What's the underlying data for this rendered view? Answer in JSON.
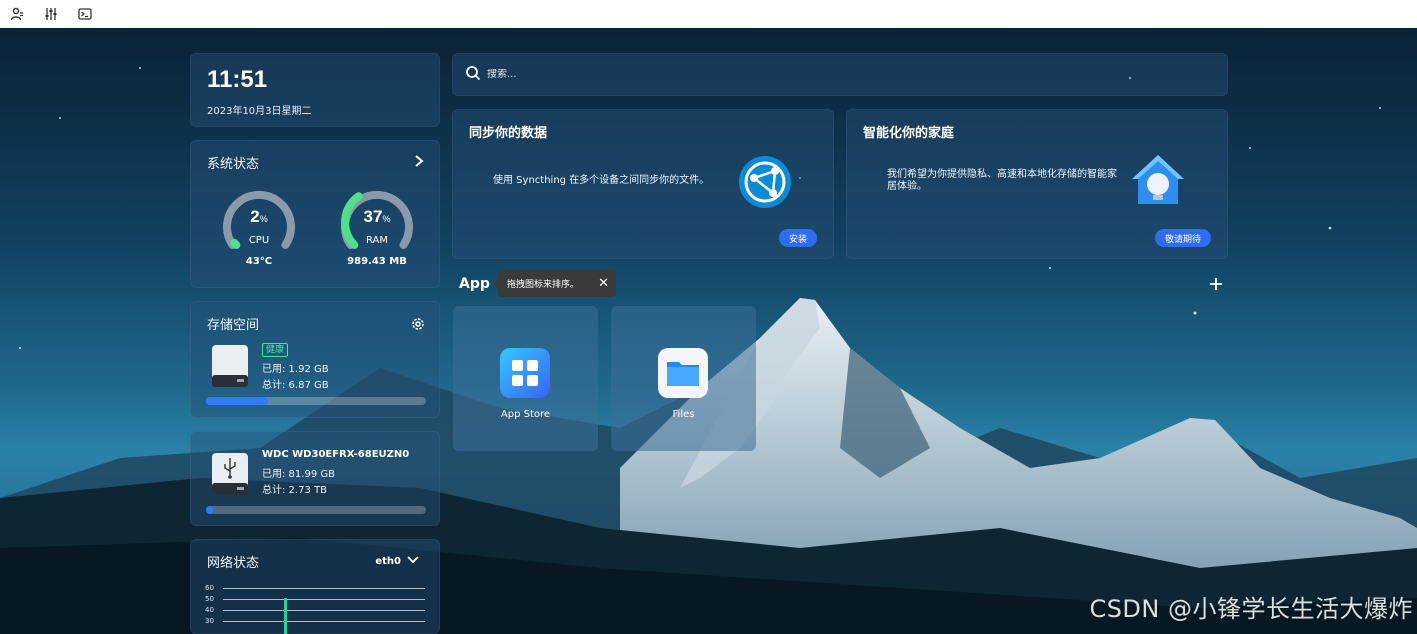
{
  "toolbar": {
    "icons": [
      "user-icon",
      "sliders-icon",
      "terminal-icon"
    ]
  },
  "clock": {
    "time": "11:51",
    "date": "2023年10月3日星期二"
  },
  "system_status": {
    "title": "系统状态",
    "cpu": {
      "value": "2",
      "unit": "%",
      "label": "CPU",
      "sub": "43°C",
      "fraction": 0.02
    },
    "ram": {
      "value": "37",
      "unit": "%",
      "label": "RAM",
      "sub": "989.43 MB",
      "fraction": 0.37
    },
    "colors": {
      "cpu_fill": "#4ee08a",
      "ram_fill": "#4ee08a",
      "track": "#8a9aaa"
    }
  },
  "storage": {
    "title": "存储空间",
    "badge": "健康",
    "used": "已用: 1.92 GB",
    "total": "总计: 6.87 GB",
    "usage_fraction": 0.28
  },
  "usb_disk": {
    "name": "WDC WD30EFRX-68EUZN0",
    "used": "已用: 81.99 GB",
    "total": "总计: 2.73 TB",
    "usage_fraction": 0.03
  },
  "network": {
    "title": "网络状态",
    "interface": "eth0",
    "y_ticks": [
      "60",
      "50",
      "40",
      "30"
    ]
  },
  "search": {
    "placeholder": "搜索..."
  },
  "promo_sync": {
    "title": "同步你的数据",
    "description": "使用 Syncthing 在多个设备之间同步你的文件。",
    "button": "安装"
  },
  "promo_home": {
    "title": "智能化你的家庭",
    "description": "我们希望为你提供隐私、高速和本地化存储的智能家居体验。",
    "button": "敬请期待"
  },
  "apps_section": {
    "title": "App",
    "tooltip": "拖拽图标来排序。",
    "apps": [
      {
        "name": "App Store",
        "icon": "app-store-icon"
      },
      {
        "name": "Files",
        "icon": "files-icon"
      }
    ]
  },
  "watermark": "CSDN @小锋学长生活大爆炸",
  "colors": {
    "accent": "#2f6cf0",
    "healthy": "#4ee0a0"
  }
}
